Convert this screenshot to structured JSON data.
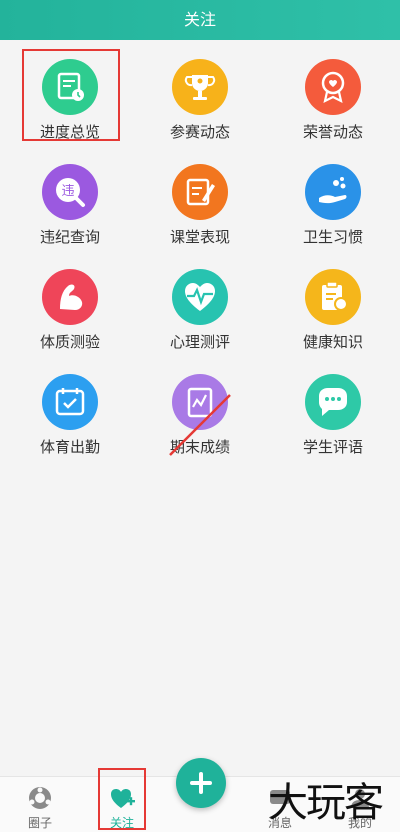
{
  "header": {
    "title": "关注"
  },
  "grid": {
    "items": [
      {
        "label": "进度总览",
        "icon": "schedule-icon",
        "color": "#2ecc8f"
      },
      {
        "label": "参赛动态",
        "icon": "trophy-icon",
        "color": "#f7b21a"
      },
      {
        "label": "荣誉动态",
        "icon": "medal-icon",
        "color": "#f45b3c"
      },
      {
        "label": "违纪查询",
        "icon": "violation-icon",
        "color": "#9b59e0"
      },
      {
        "label": "课堂表现",
        "icon": "pencil-note-icon",
        "color": "#f2761f"
      },
      {
        "label": "卫生习惯",
        "icon": "hand-wash-icon",
        "color": "#2a92e8"
      },
      {
        "label": "体质测验",
        "icon": "arm-strength-icon",
        "color": "#ef4559"
      },
      {
        "label": "心理测评",
        "icon": "heartbeat-icon",
        "color": "#27c3b0"
      },
      {
        "label": "健康知识",
        "icon": "clipboard-icon",
        "color": "#f5b61b"
      },
      {
        "label": "体育出勤",
        "icon": "calendar-check-icon",
        "color": "#2c9ff0"
      },
      {
        "label": "期末成绩",
        "icon": "grade-chart-icon",
        "color": "#a97ae6"
      },
      {
        "label": "学生评语",
        "icon": "chat-bubble-icon",
        "color": "#2ec9a7"
      }
    ]
  },
  "tabbar": {
    "tabs": [
      {
        "label": "圈子",
        "icon": "circle-nav-icon"
      },
      {
        "label": "关注",
        "icon": "heart-plus-icon",
        "color": "#1fb29a"
      },
      {
        "label": "消息",
        "icon": "message-icon"
      },
      {
        "label": "我的",
        "icon": "profile-icon"
      }
    ],
    "fab_icon": "plus-icon"
  },
  "watermark": {
    "text": "大玩客"
  }
}
